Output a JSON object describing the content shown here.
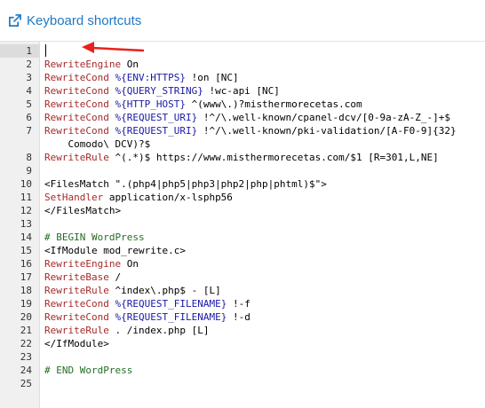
{
  "toolbar": {
    "shortcuts_label": "Keyboard shortcuts",
    "icon": "external-link-icon",
    "link_color": "#1f78c2"
  },
  "editor": {
    "lines": [
      {
        "n": "1",
        "t": ""
      },
      {
        "n": "2",
        "t": "RewriteEngine On"
      },
      {
        "n": "3",
        "t": "RewriteCond %{ENV:HTTPS} !on [NC]"
      },
      {
        "n": "4",
        "t": "RewriteCond %{QUERY_STRING} !wc-api [NC]"
      },
      {
        "n": "5",
        "t": "RewriteCond %{HTTP_HOST} ^(www\\.)?misthermorecetas.com"
      },
      {
        "n": "6",
        "t": "RewriteCond %{REQUEST_URI} !^/\\.well-known/cpanel-dcv/[0-9a-zA-Z_-]+$"
      },
      {
        "n": "7",
        "t": "RewriteCond %{REQUEST_URI} !^/\\.well-known/pki-validation/[A-F0-9]{32}"
      },
      {
        "n": "",
        "t": "    Comodo\\ DCV)?$"
      },
      {
        "n": "8",
        "t": "RewriteRule ^(.*)$ https://www.misthermorecetas.com/$1 [R=301,L,NE]"
      },
      {
        "n": "9",
        "t": ""
      },
      {
        "n": "10",
        "t": "<FilesMatch \".(php4|php5|php3|php2|php|phtml)$\">"
      },
      {
        "n": "11",
        "t": "SetHandler application/x-lsphp56"
      },
      {
        "n": "12",
        "t": "</FilesMatch>"
      },
      {
        "n": "13",
        "t": ""
      },
      {
        "n": "14",
        "t": "# BEGIN WordPress"
      },
      {
        "n": "15",
        "t": "<IfModule mod_rewrite.c>"
      },
      {
        "n": "16",
        "t": "RewriteEngine On"
      },
      {
        "n": "17",
        "t": "RewriteBase /"
      },
      {
        "n": "18",
        "t": "RewriteRule ^index\\.php$ - [L]"
      },
      {
        "n": "19",
        "t": "RewriteCond %{REQUEST_FILENAME} !-f"
      },
      {
        "n": "20",
        "t": "RewriteCond %{REQUEST_FILENAME} !-d"
      },
      {
        "n": "21",
        "t": "RewriteRule . /index.php [L]"
      },
      {
        "n": "22",
        "t": "</IfModule>"
      },
      {
        "n": "23",
        "t": ""
      },
      {
        "n": "24",
        "t": "# END WordPress"
      },
      {
        "n": "25",
        "t": ""
      }
    ],
    "active_line": "1",
    "annotation": "red-arrow-pointing-to-line-1"
  },
  "colors": {
    "keyword": "#a52a2a",
    "variable": "#1a1aa6",
    "comment": "#236e25",
    "gutter_bg": "#f0f0f0",
    "arrow": "#e8221b"
  }
}
